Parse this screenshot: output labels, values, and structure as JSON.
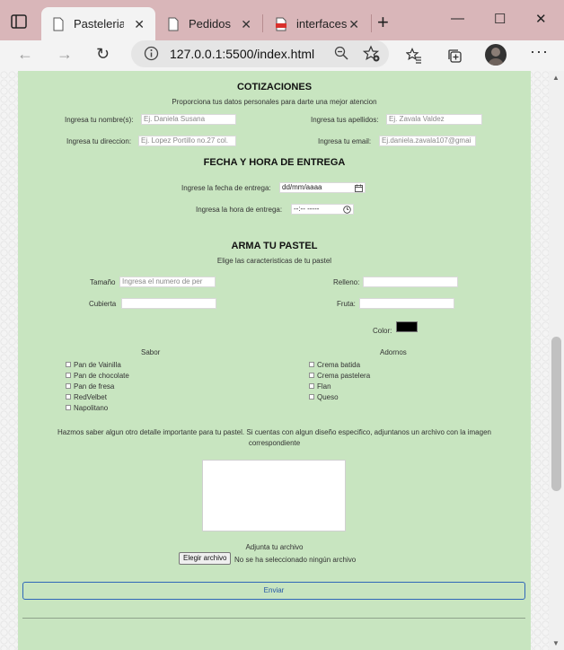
{
  "browser": {
    "tabs": [
      {
        "label": "Pasteleria"
      },
      {
        "label": "Pedidos"
      },
      {
        "label": "interfaces."
      }
    ],
    "url": "127.0.0.1:5500/index.html"
  },
  "page": {
    "cotizaciones": {
      "title": "COTIZACIONES",
      "subtitle": "Proporciona tus datos personales para darte una mejor atencion",
      "nombre_label": "Ingresa tu nombre(s):",
      "nombre_placeholder": "Ej. Daniela Susana",
      "apellidos_label": "Ingresa tus apellidos:",
      "apellidos_placeholder": "Ej. Zavala Valdez",
      "direccion_label": "Ingresa tu direccion:",
      "direccion_placeholder": "Ej. Lopez Portillo no.27 col.",
      "email_label": "Ingresa tu email:",
      "email_placeholder": "Ej.daniela.zavala107@gmai"
    },
    "entrega": {
      "title": "FECHA Y HORA DE ENTREGA",
      "fecha_label": "Ingrese la fecha de entrega:",
      "fecha_value": "dd/mm/aaaa",
      "hora_label": "Ingresa la hora de entrega:",
      "hora_value": "--:-- -----"
    },
    "pastel": {
      "title": "ARMA TU PASTEL",
      "subtitle": "Elige las caracteristicas de tu pastel",
      "tamano_label": "Tamaño",
      "tamano_placeholder": "Ingresa el numero de per",
      "relleno_label": "Relleno:",
      "cubierta_label": "Cubierta",
      "fruta_label": "Fruta:",
      "color_label": "Color:",
      "color_value": "#000000",
      "sabor_title": "Sabor",
      "sabores": [
        "Pan de Vainilla",
        "Pan de chocolate",
        "Pan de fresa",
        "RedVelbet",
        "Napolitano"
      ],
      "adornos_title": "Adornos",
      "adornos": [
        "Crema batida",
        "Crema pastelera",
        "Flan",
        "Queso"
      ]
    },
    "detalles": {
      "text": "Hazmos saber algun otro detalle importante para tu pastel. Si cuentas con algun diseño especifico, adjuntanos un archivo con la imagen correspondiente",
      "adjunta_label": "Adjunta tu archivo",
      "file_button": "Elegir archivo",
      "file_status": "No se ha seleccionado ningún archivo"
    },
    "submit_label": "Enviar"
  },
  "colors": {
    "panel_bg": "#c8e5c0",
    "titlebar_bg": "#d9b6b9",
    "pdf_red": "#d9302c",
    "submit_border": "#2f67b8"
  }
}
